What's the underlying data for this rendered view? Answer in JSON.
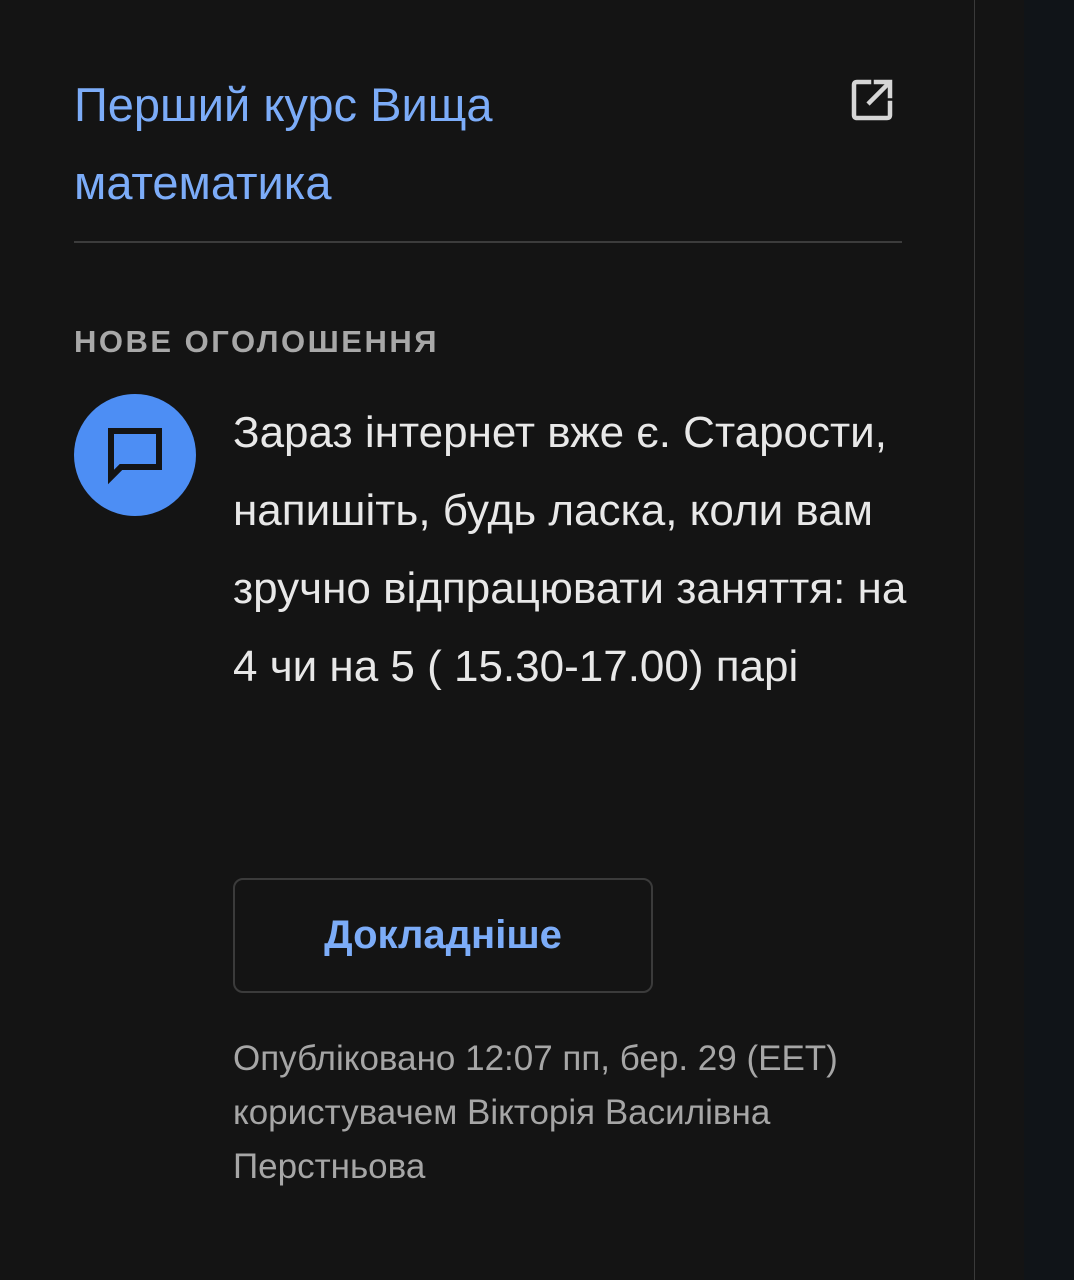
{
  "card": {
    "course_title": "Перший курс Вища математика",
    "open_icon": "open-in-new-icon",
    "section_label": "НОВЕ ОГОЛОШЕННЯ",
    "avatar_icon": "announcement-chat-icon",
    "announcement_text": "Зараз інтернет вже є. Старости, напишіть, будь ласка, коли вам зручно відпрацювати заняття: на 4 чи на 5 ( 15.30-17.00) парі",
    "details_button_label": "Докладніше",
    "posted_meta": "Опубліковано 12:07 пп, бер. 29 (EET) користувачем Вікторія Василівна Перстньова"
  },
  "colors": {
    "background": "#141414",
    "accent_link": "#7cacf8",
    "avatar_bg": "#4d8ef4",
    "primary_text": "#e8e8e8",
    "secondary_text": "#a6a6a6"
  }
}
